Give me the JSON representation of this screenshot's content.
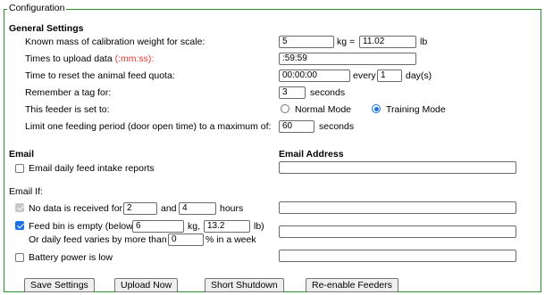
{
  "fieldset": {
    "legend": "Configuration"
  },
  "general": {
    "heading": "General Settings",
    "calibration": {
      "label": "Known mass of calibration weight for scale:",
      "kg_value": "5",
      "kg_unit": "kg =",
      "lb_value": "11.02",
      "lb_unit": "lb"
    },
    "upload_times": {
      "label": "Times to upload data ",
      "hint": "(:mm:ss):",
      "value": ":59:59"
    },
    "reset_quota": {
      "label": "Time to reset the animal feed quota:",
      "time_value": "00:00:00",
      "every_label": "every",
      "days_value": "1",
      "days_unit": "day(s)"
    },
    "remember_tag": {
      "label": "Remember a tag for:",
      "value": "3",
      "unit": "seconds"
    },
    "feeder_mode": {
      "label": "This feeder is set to:",
      "options": [
        "Normal Mode",
        "Training Mode"
      ],
      "selected": "Training Mode"
    },
    "feeding_limit": {
      "label": "Limit one feeding period (door open time) to a maximum of:",
      "value": "60",
      "unit": "seconds"
    }
  },
  "email": {
    "heading": "Email",
    "address_heading": "Email Address",
    "daily_report": {
      "label": "Email daily feed intake reports",
      "checked": false,
      "email": ""
    },
    "email_if_label": "Email If:",
    "no_data": {
      "prefix": "No data is received for",
      "value1": "2",
      "and_label": "and",
      "value2": "4",
      "unit": "hours",
      "checked": true,
      "disabled": true,
      "email": ""
    },
    "feed_bin": {
      "prefix": "Feed bin is empty (below",
      "kg_value": "6",
      "kg_unit": "kg,",
      "lb_value": "13.2",
      "lb_unit": "lb)",
      "checked": true,
      "email": ""
    },
    "daily_varies": {
      "prefix": "Or daily feed varies by more than",
      "value": "0",
      "suffix": "% in a week",
      "email": ""
    },
    "battery": {
      "label": "Battery power is low",
      "checked": false,
      "email": ""
    }
  },
  "buttons": {
    "save": "Save Settings",
    "upload": "Upload Now",
    "shutdown": "Short Shutdown",
    "reenable": "Re-enable Feeders"
  }
}
